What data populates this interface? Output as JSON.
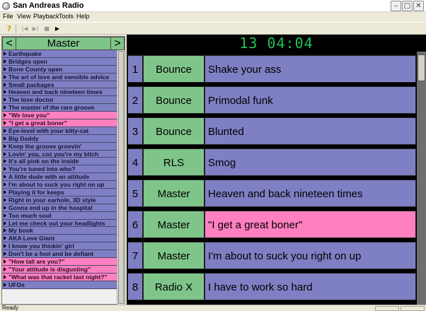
{
  "window": {
    "title": "San Andreas Radio",
    "min_glyph": "–",
    "max_glyph": "□",
    "close_glyph": "✕"
  },
  "menu": [
    "File",
    "View",
    "Playback",
    "Tools",
    "Help"
  ],
  "toolbar": {
    "help_glyph": "?",
    "prev_glyph": "|◀",
    "next_glyph": "▶|",
    "stop_glyph": "■",
    "play_glyph": "▶"
  },
  "left_panel": {
    "title": "Master",
    "prev_arrow": "<",
    "next_arrow": ">",
    "songs": [
      {
        "label": "Earthquake",
        "highlight": false
      },
      {
        "label": "Bridges open",
        "highlight": false
      },
      {
        "label": "Bone County open",
        "highlight": false
      },
      {
        "label": "The art of love and sensible advice",
        "highlight": false
      },
      {
        "label": "Small packages",
        "highlight": false
      },
      {
        "label": "Heaven and back nineteen times",
        "highlight": false
      },
      {
        "label": "The love doctor",
        "highlight": false
      },
      {
        "label": "The master of the rare groove",
        "highlight": false
      },
      {
        "label": "\"We love you\"",
        "highlight": true
      },
      {
        "label": "\"I get a great boner\"",
        "highlight": true
      },
      {
        "label": "Eye-level with your kitty-cat",
        "highlight": false
      },
      {
        "label": "Big Daddy",
        "highlight": false
      },
      {
        "label": "Keep the groove groovin'",
        "highlight": false
      },
      {
        "label": "Lovin' you, coz you're my bitch",
        "highlight": false
      },
      {
        "label": "It's all pink on the inside",
        "highlight": false
      },
      {
        "label": "You're tuned into who?",
        "highlight": false
      },
      {
        "label": "A little dude with an attitude",
        "highlight": false
      },
      {
        "label": "I'm about to suck you right on up",
        "highlight": false
      },
      {
        "label": "Playing it for keeps",
        "highlight": false
      },
      {
        "label": "Right in your earhole, 3D style",
        "highlight": false
      },
      {
        "label": "Gonna end up in the hospital",
        "highlight": false
      },
      {
        "label": "Too much soul",
        "highlight": false
      },
      {
        "label": "Let me check out your headlights",
        "highlight": false
      },
      {
        "label": "My book",
        "highlight": false
      },
      {
        "label": "AKA Love Giant",
        "highlight": false
      },
      {
        "label": "I know you thinkin' girl",
        "highlight": false
      },
      {
        "label": "Don't be a fool and be defiant",
        "highlight": false
      },
      {
        "label": "\"How tall are you?\"",
        "highlight": true
      },
      {
        "label": "\"Your attitude is disgusting\"",
        "highlight": true
      },
      {
        "label": "\"What was that racket last night?\"",
        "highlight": true
      },
      {
        "label": "UFOs",
        "highlight": false
      }
    ]
  },
  "clock": "13 04:04",
  "queue": [
    {
      "num": "1",
      "category": "Bounce",
      "title": "Shake your ass",
      "highlight": false
    },
    {
      "num": "2",
      "category": "Bounce",
      "title": "Primodal funk",
      "highlight": false
    },
    {
      "num": "3",
      "category": "Bounce",
      "title": "Blunted",
      "highlight": false
    },
    {
      "num": "4",
      "category": "RLS",
      "title": "Smog",
      "highlight": false
    },
    {
      "num": "5",
      "category": "Master",
      "title": "Heaven and back nineteen times",
      "highlight": false
    },
    {
      "num": "6",
      "category": "Master",
      "title": "\"I get a great boner\"",
      "highlight": true
    },
    {
      "num": "7",
      "category": "Master",
      "title": "I'm about to suck you right on up",
      "highlight": false
    },
    {
      "num": "8",
      "category": "Radio X",
      "title": "I have to work so hard",
      "highlight": false
    }
  ],
  "status": {
    "text": "Ready"
  },
  "colors": {
    "blue": "#7f7fc4",
    "green": "#7fc58a",
    "pink": "#ff80c0",
    "clock": "#22c15a"
  }
}
